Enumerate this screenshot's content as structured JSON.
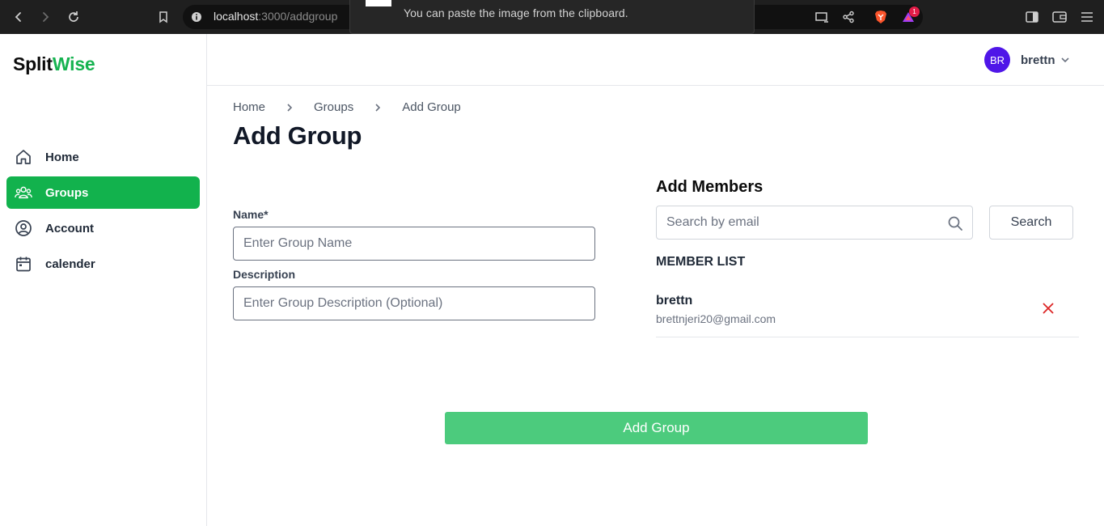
{
  "browser": {
    "url_host": "localhost",
    "url_path": ":3000/addgroup",
    "toast_message": "You can paste the image from the clipboard.",
    "notification_count": "1"
  },
  "sidebar": {
    "logo_part1": "Split",
    "logo_part2": "Wise",
    "items": [
      {
        "label": "Home",
        "icon": "home-icon",
        "active": false
      },
      {
        "label": "Groups",
        "icon": "users-icon",
        "active": true
      },
      {
        "label": "Account",
        "icon": "user-circle-icon",
        "active": false
      },
      {
        "label": "calender",
        "icon": "calendar-icon",
        "active": false
      }
    ]
  },
  "header": {
    "avatar_initials": "BR",
    "username": "brettn"
  },
  "breadcrumb": [
    "Home",
    "Groups",
    "Add Group"
  ],
  "page_title": "Add Group",
  "form": {
    "name_label": "Name*",
    "name_placeholder": "Enter Group Name",
    "name_value": "",
    "description_label": "Description",
    "description_placeholder": "Enter Group Description (Optional)",
    "description_value": ""
  },
  "members": {
    "title": "Add Members",
    "search_placeholder": "Search by email",
    "search_button": "Search",
    "list_title": "MEMBER LIST",
    "list": [
      {
        "name": "brettn",
        "email": "brettnjeri20@gmail.com"
      }
    ]
  },
  "submit_label": "Add Group",
  "colors": {
    "brand_green": "#16b350",
    "active_nav": "#12b24d",
    "submit_button": "#4ccb7d",
    "avatar": "#4f16e8",
    "remove": "#dc2626"
  }
}
